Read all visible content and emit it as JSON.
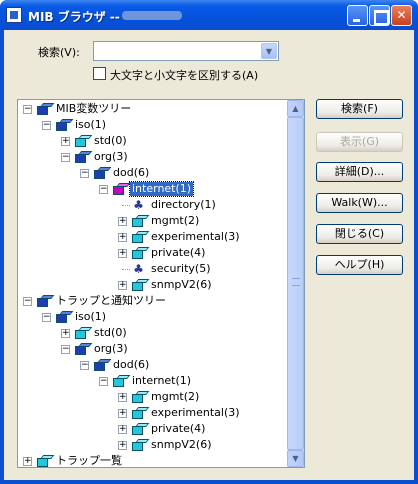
{
  "window": {
    "title": "MIB ブラウザ --"
  },
  "search": {
    "label": "検索(V):",
    "value": "",
    "case_label": "大文字と小文字を区別する(A)"
  },
  "buttons": {
    "search": "検索(F)",
    "show": "表示(G)",
    "details": "詳細(D)...",
    "walk": "Walk(W)...",
    "close": "閉じる(C)",
    "help": "ヘルプ(H)"
  },
  "tree": [
    {
      "label": "MIB変数ツリー"
    },
    {
      "label": "iso(1)"
    },
    {
      "label": "std(0)"
    },
    {
      "label": "org(3)"
    },
    {
      "label": "dod(6)"
    },
    {
      "label": "internet(1)"
    },
    {
      "label": "directory(1)"
    },
    {
      "label": "mgmt(2)"
    },
    {
      "label": "experimental(3)"
    },
    {
      "label": "private(4)"
    },
    {
      "label": "security(5)"
    },
    {
      "label": "snmpV2(6)"
    },
    {
      "label": "トラップと通知ツリー"
    },
    {
      "label": "iso(1)"
    },
    {
      "label": "std(0)"
    },
    {
      "label": "org(3)"
    },
    {
      "label": "dod(6)"
    },
    {
      "label": "internet(1)"
    },
    {
      "label": "mgmt(2)"
    },
    {
      "label": "experimental(3)"
    },
    {
      "label": "private(4)"
    },
    {
      "label": "snmpV2(6)"
    },
    {
      "label": "トラップ一覧"
    }
  ],
  "colors": {
    "titlebar": "#0552dc",
    "selection": "#316ac5",
    "dialog": "#ece9d8"
  }
}
